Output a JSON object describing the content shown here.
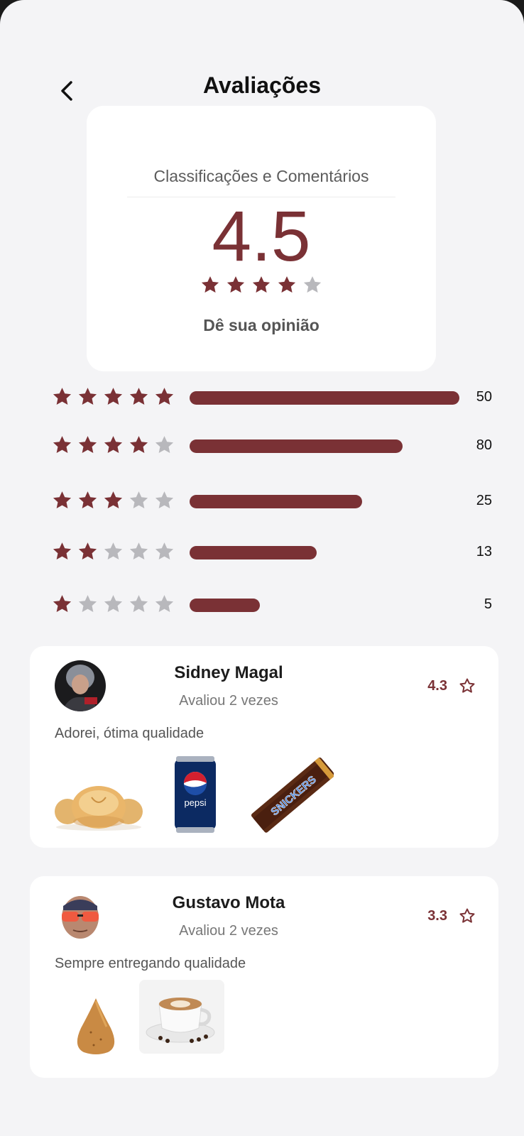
{
  "header": {
    "title": "Avaliações",
    "back_icon": "chevron-left-icon"
  },
  "summary": {
    "heading": "Classificações e Comentários",
    "score": "4.5",
    "stars": [
      1,
      1,
      1,
      1,
      0
    ],
    "opinion_label": "Dê sua opinião"
  },
  "breakdown": [
    {
      "filled": 5,
      "count": "50",
      "fraction": 1.0
    },
    {
      "filled": 4,
      "count": "80",
      "fraction": 0.79
    },
    {
      "filled": 3,
      "count": "25",
      "fraction": 0.64
    },
    {
      "filled": 2,
      "count": "13",
      "fraction": 0.47
    },
    {
      "filled": 1,
      "count": "5",
      "fraction": 0.26
    }
  ],
  "reviews": [
    {
      "name": "Sidney Magal",
      "subtitle": "Avaliou 2 vezes",
      "rating": "4.3",
      "text": "Adorei, ótima qualidade",
      "products": [
        "pao-de-queijo-image",
        "pepsi-can-image",
        "snickers-bar-image"
      ]
    },
    {
      "name": "Gustavo Mota",
      "subtitle": "Avaliou 2 vezes",
      "rating": "3.3",
      "text": "Sempre entregando qualidade",
      "products": [
        "coxinha-image",
        "cappuccino-image"
      ]
    }
  ],
  "colors": {
    "accent": "#7a3135",
    "star_empty": "#b8b8bc",
    "background": "#f4f4f6",
    "card": "#ffffff"
  }
}
